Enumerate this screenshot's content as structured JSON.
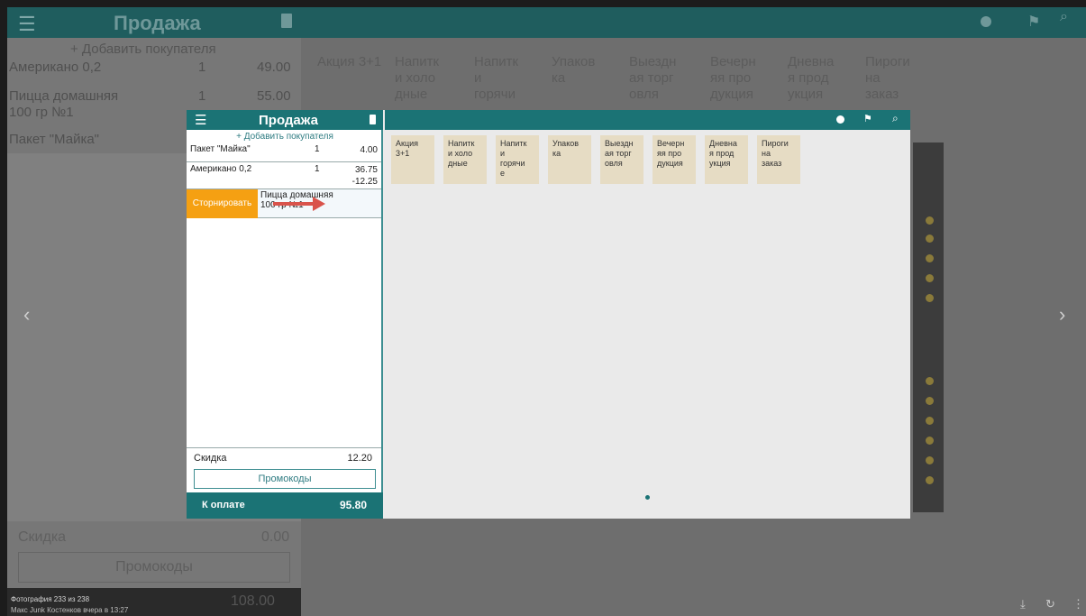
{
  "background_app": {
    "title": "Продажа",
    "add_customer": "+ Добавить покупателя",
    "items": [
      {
        "name": "Американо 0,2",
        "qty": "1",
        "price": "49.00"
      },
      {
        "name": "Пицца домашняя",
        "qty": "1",
        "price": "55.00"
      },
      {
        "name": "100 гр №1"
      },
      {
        "name": "Пакет \"Майка\""
      }
    ],
    "categories": [
      "Акция 3+1",
      "Напитк и холо дные",
      "Напитк и горячи",
      "Упаков ка",
      "Выездн ая торг овля",
      "Вечерн яя про дукция",
      "Дневна я прод укция",
      "Пироги на заказ"
    ],
    "discount_label": "Скидка",
    "discount_value": "0.00",
    "promo_label": "Промокоды",
    "total": "108.00"
  },
  "viewer": {
    "photo_counter": "Фотография 233 из 238",
    "author_line": "Макс Junk Костенков  вчера в 13:27"
  },
  "screenshot": {
    "header": {
      "title": "Продажа"
    },
    "add_customer": "+ Добавить покупателя",
    "items": [
      {
        "name": "Пакет \"Майка\"",
        "qty": "1",
        "price": "4.00"
      },
      {
        "name": "Американо 0,2",
        "qty": "1",
        "price": "36.75",
        "discount": "-12.25"
      }
    ],
    "storno": {
      "button": "Сторнировать",
      "item_line1": "Пицца домашняя",
      "item_line2": "100 гр №1"
    },
    "discount_label": "Скидка",
    "discount_value": "12.20",
    "promo_label": "Промокоды",
    "pay_label": "К оплате",
    "total": "95.80",
    "categories": [
      {
        "line1": "Акция",
        "line2": "3+1"
      },
      {
        "line1": "Напитк",
        "line2": "и холо",
        "line3": "дные"
      },
      {
        "line1": "Напитк",
        "line2": "и",
        "line3": "горячи",
        "line4": "е"
      },
      {
        "line1": "Упаков",
        "line2": "ка"
      },
      {
        "line1": "Выездн",
        "line2": "ая торг",
        "line3": "овля"
      },
      {
        "line1": "Вечерн",
        "line2": "яя про",
        "line3": "дукция"
      },
      {
        "line1": "Дневна",
        "line2": "я прод",
        "line3": "укция"
      },
      {
        "line1": "Пироги",
        "line2": "на",
        "line3": "заказ"
      }
    ]
  },
  "colors": {
    "teal": "#1b7375",
    "orange": "#f5a012",
    "category_bg": "#e6dcc4",
    "arrow": "#d9534b"
  }
}
